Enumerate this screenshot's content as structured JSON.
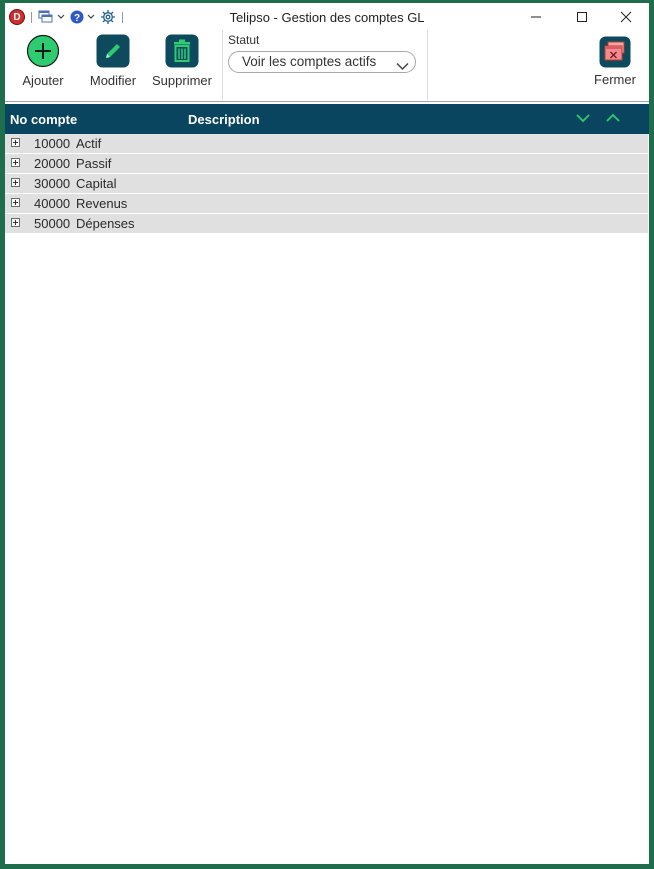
{
  "window": {
    "title": "Telipso - Gestion des comptes GL",
    "logo_letter": "D",
    "quick_access_icons": [
      "windows-icon",
      "help-icon",
      "gear-icon"
    ]
  },
  "ribbon": {
    "add_label": "Ajouter",
    "edit_label": "Modifier",
    "delete_label": "Supprimer",
    "status_label": "Statut",
    "status_value": "Voir les comptes actifs",
    "close_label": "Fermer"
  },
  "table": {
    "col_account": "No compte",
    "col_description": "Description",
    "rows": [
      {
        "account": "10000",
        "description": "Actif"
      },
      {
        "account": "20000",
        "description": "Passif"
      },
      {
        "account": "30000",
        "description": "Capital"
      },
      {
        "account": "40000",
        "description": "Revenus"
      },
      {
        "account": "50000",
        "description": "Dépenses"
      }
    ]
  },
  "colors": {
    "accent_green": "#2ecc71",
    "header_blue": "#0a4560",
    "button_teal": "#0e4a5e",
    "row_gray": "#e0e0e0",
    "frame_green": "#1e6e4e"
  }
}
